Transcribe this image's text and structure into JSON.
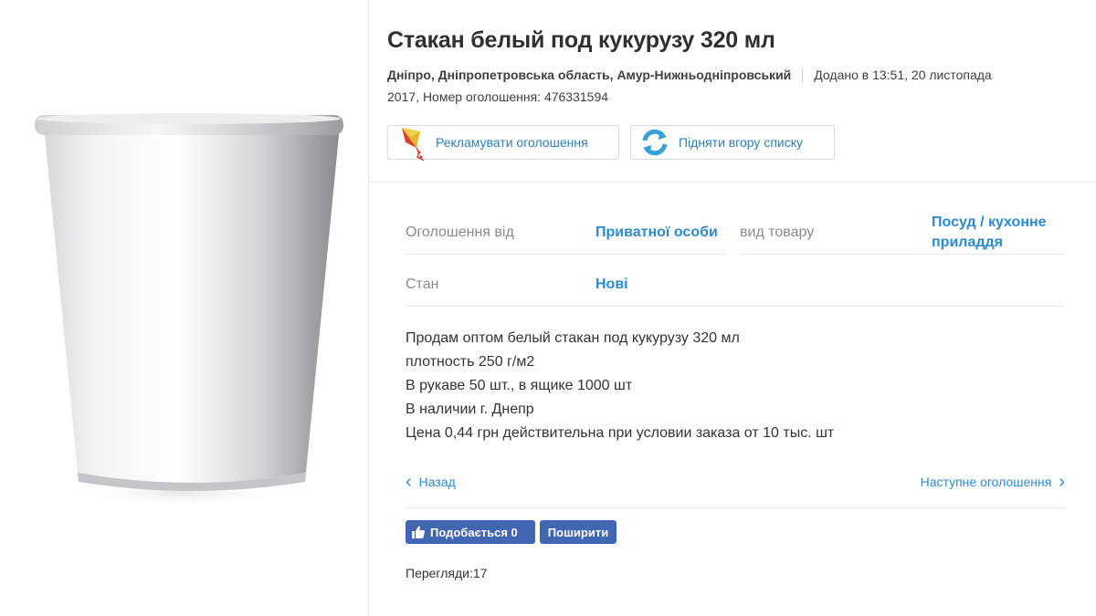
{
  "listing": {
    "title": "Стакан белый под кукурузу 320 мл",
    "location": "Дніпро, Дніпропетровська область, Амур-Нижньодніпровський",
    "added_prefix": "Додано в 13:51, 20 листопада",
    "added_year": "2017,",
    "id_label": "Номер оголошення: 476331594"
  },
  "actions": {
    "promote_label": "Рекламувати оголошення",
    "raise_label": "Підняти вгору списку"
  },
  "params": {
    "from_label": "Оголошення від",
    "from_value": "Приватної особи",
    "type_label": "вид товару",
    "type_value": "Посуд / кухонне приладдя",
    "condition_label": "Стан",
    "condition_value": "Нові"
  },
  "description": [
    "Продам оптом белый стакан под кукурузу 320 мл",
    "плотность 250 г/м2",
    "В рукаве 50 шт., в ящике 1000 шт",
    "В наличии г. Днепр",
    "Цена 0,44 грн действительна при условии заказа от 10 тыс. шт"
  ],
  "nav": {
    "prev_label": "Назад",
    "next_label": "Наступне оголошення"
  },
  "social": {
    "like_label": "Подобається 0",
    "share_label": "Поширити"
  },
  "views": {
    "label": "Перегляди:17"
  },
  "icons": {
    "promote": "kite-icon",
    "raise": "refresh-arrows-icon",
    "prev": "chevron-left-icon",
    "next": "chevron-right-icon",
    "like": "thumbs-up-icon"
  },
  "colors": {
    "link_blue": "#2b8ad0",
    "facebook_blue": "#4267b2"
  }
}
